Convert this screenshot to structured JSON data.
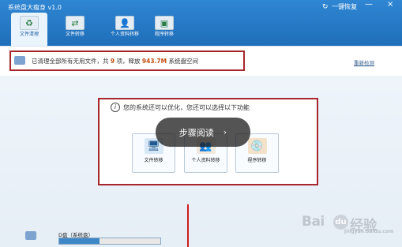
{
  "window": {
    "title": "系统盘大瘦身 v1.0",
    "restore_label": "一键恢复",
    "minimize": "—",
    "close": "×"
  },
  "tabs": [
    {
      "label": "文件清理",
      "icon": "♻"
    },
    {
      "label": "文件转移",
      "icon": "⇄"
    },
    {
      "label": "个人资料转移",
      "icon": "👤"
    },
    {
      "label": "程序转移",
      "icon": "▣"
    }
  ],
  "status": {
    "prefix": "已清理全部所有无用文件，共",
    "count": "9",
    "mid": "项，释放",
    "size": "943.7M",
    "suffix": "系统盘空间",
    "rescan_label": "重新检测"
  },
  "optimize": {
    "heading": "您的系统还可以优化，您还可以选择以下功能",
    "buttons": [
      {
        "label": "文件转移",
        "icon": "🖥"
      },
      {
        "label": "个人资料转移",
        "icon": "👥"
      },
      {
        "label": "程序转移",
        "icon": "💿"
      }
    ]
  },
  "overlay": {
    "label": "步骤阅读",
    "chevron": "›"
  },
  "disk": {
    "label": "D盘（系统盘）",
    "usage_fraction": 0.4
  },
  "watermark": {
    "text": "Bai",
    "paw": "du",
    "tail": "经验",
    "url": "jingyan.baidu.com"
  }
}
